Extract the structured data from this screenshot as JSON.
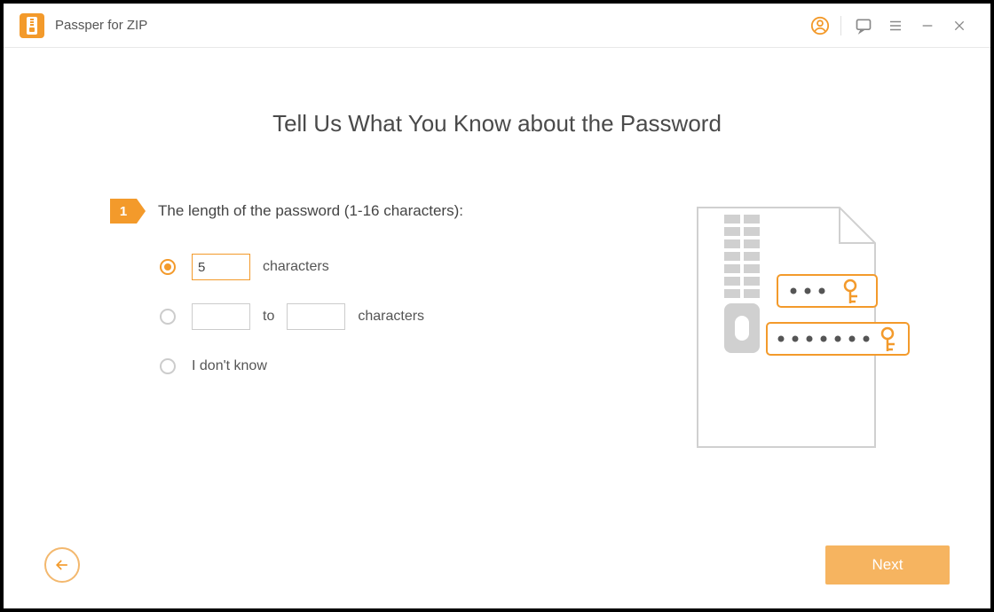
{
  "app": {
    "title": "Passper for ZIP"
  },
  "page": {
    "heading": "Tell Us What You Know about the Password",
    "step": {
      "number": "1",
      "label": "The length of the password (1-16 characters):"
    },
    "options": {
      "exact": {
        "value": "5",
        "suffix": "characters"
      },
      "range": {
        "from": "",
        "to_label": "to",
        "to": "",
        "suffix": "characters"
      },
      "unknown": {
        "label": "I don't know"
      }
    }
  },
  "buttons": {
    "next": "Next"
  }
}
